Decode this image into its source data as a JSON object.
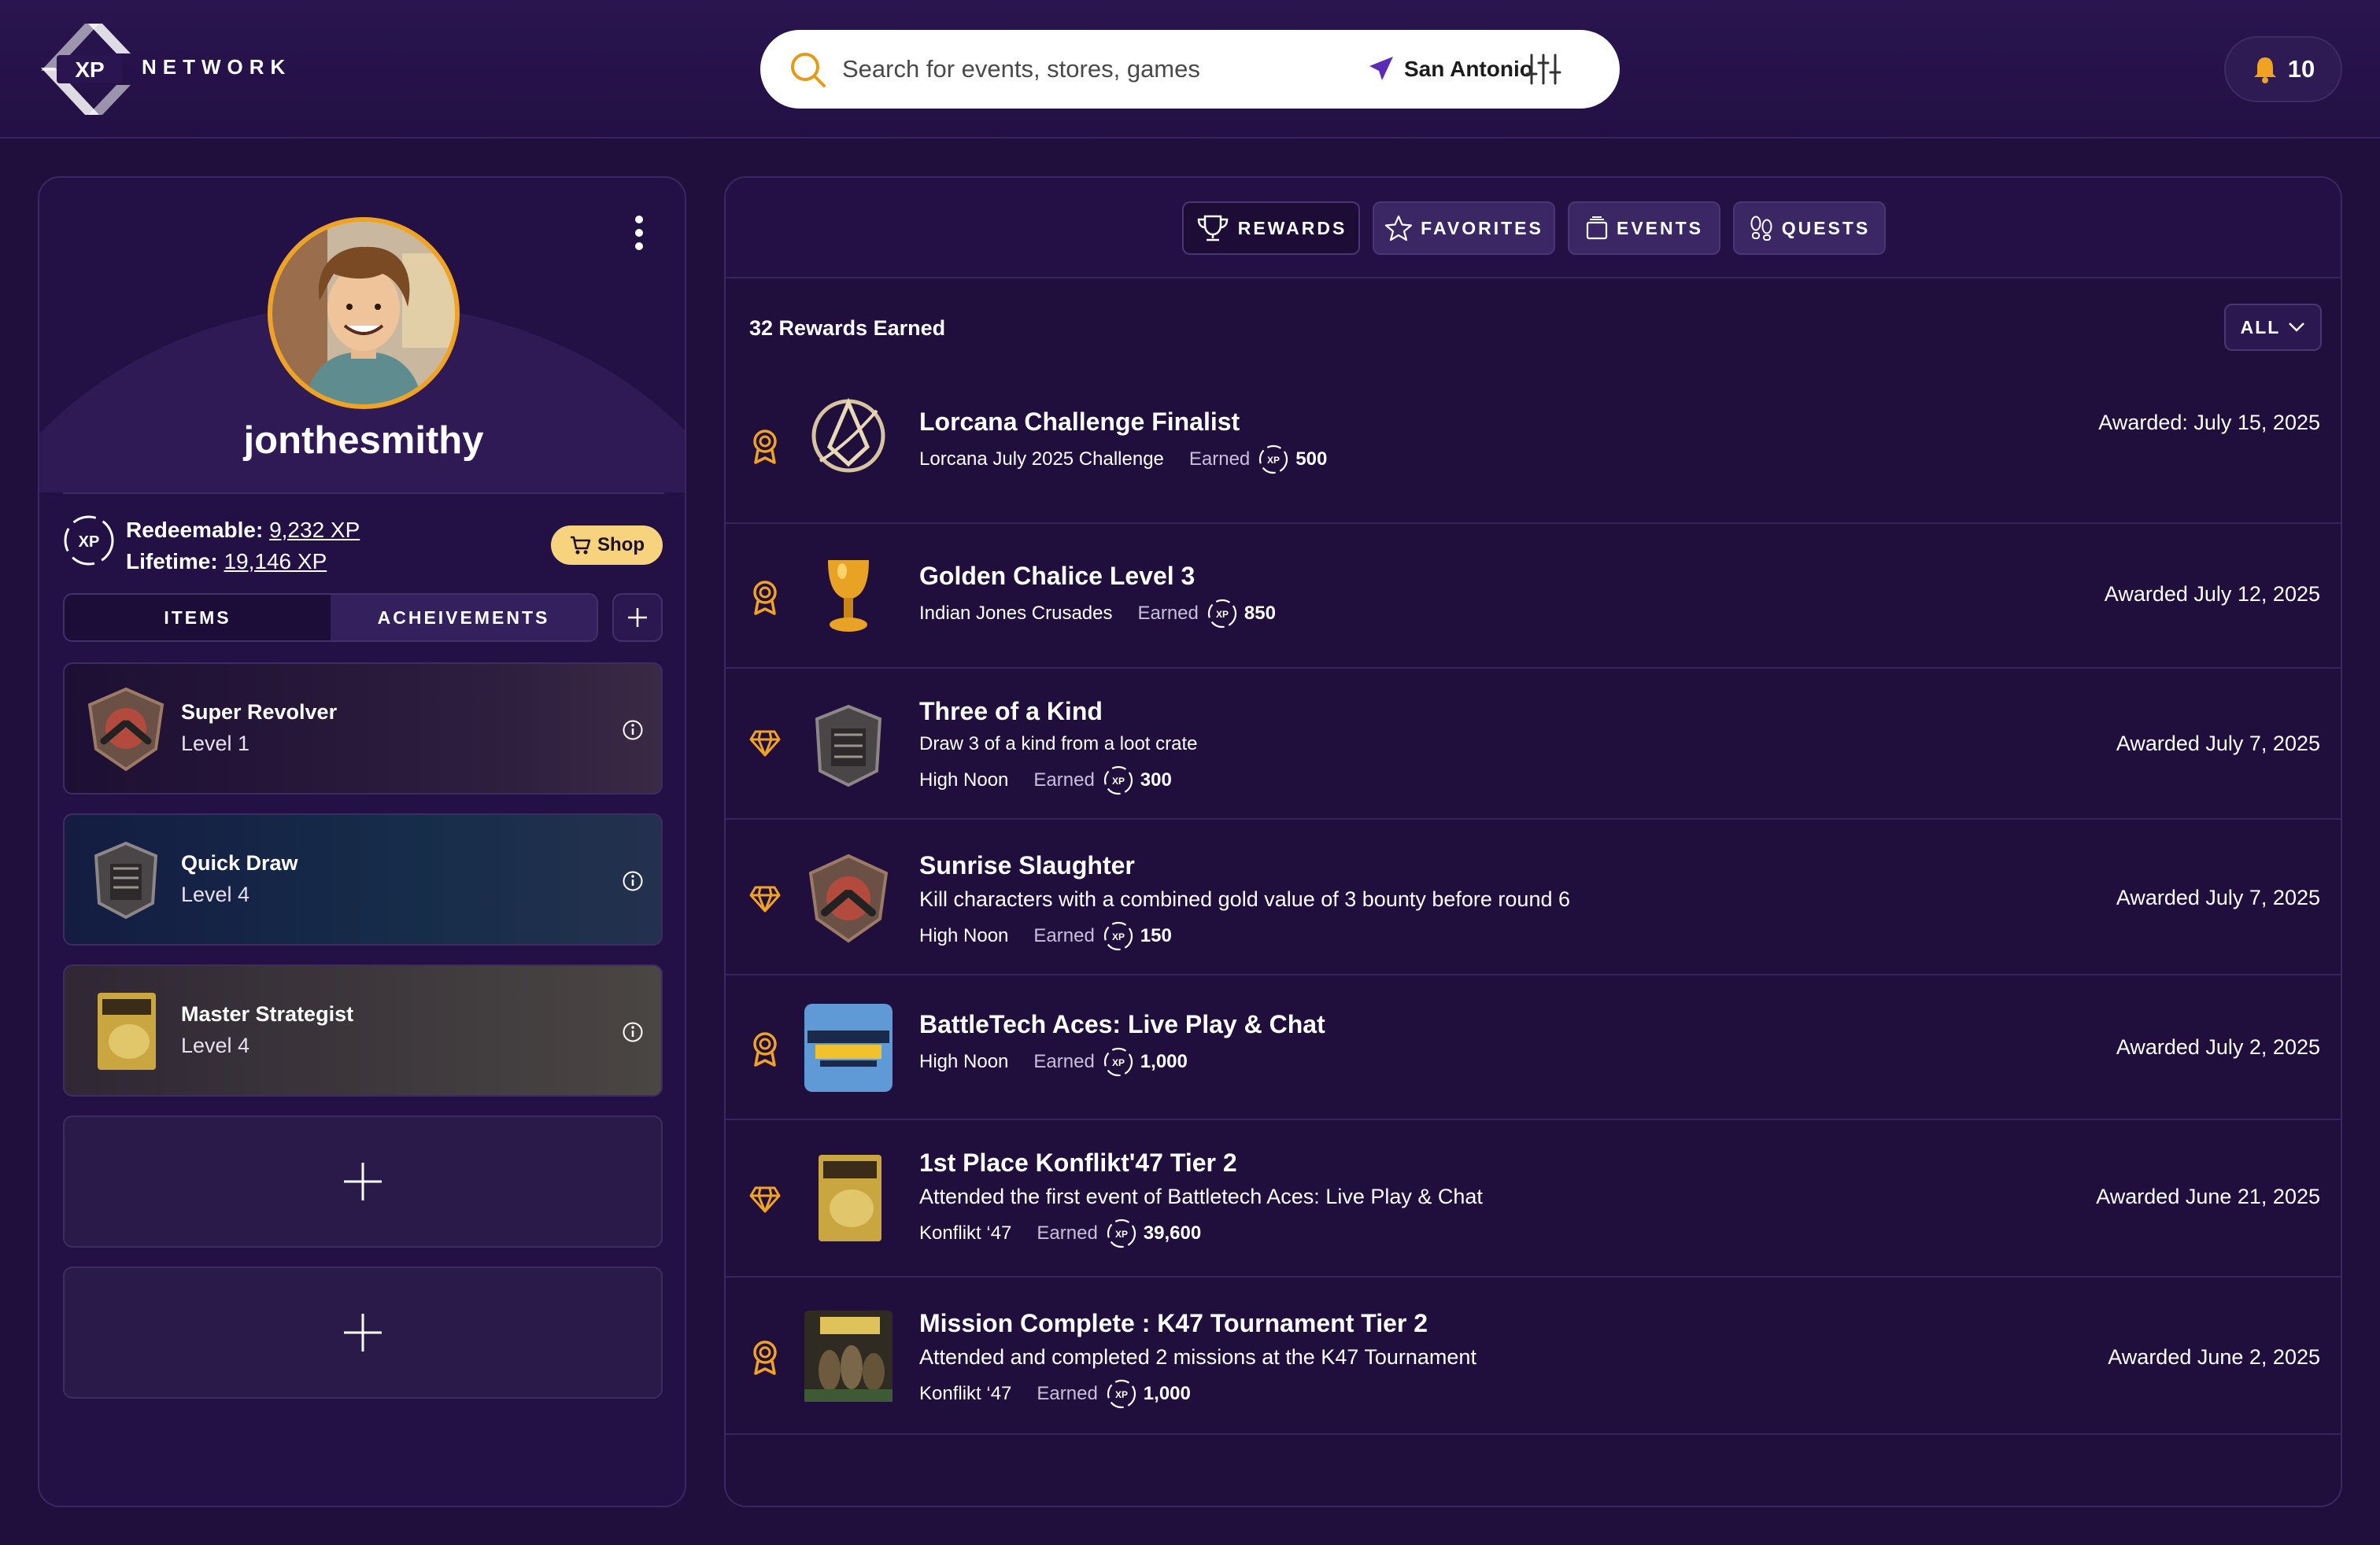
{
  "brand": {
    "xp": "XP",
    "network": "NETWORK"
  },
  "search": {
    "placeholder": "Search for events, stores, games",
    "location": "San Antonio"
  },
  "notifications": {
    "count": "10"
  },
  "profile": {
    "username": "jonthesmithy",
    "redeemable_label": "Redeemable:",
    "redeemable_value": "9,232 XP",
    "lifetime_label": "Lifetime:",
    "lifetime_value": "19,146 XP",
    "shop_label": "Shop",
    "tabs": [
      "ITEMS",
      "ACHEIVEMENTS"
    ],
    "achievements": [
      {
        "name": "Super Revolver",
        "level": "Level 1"
      },
      {
        "name": "Quick Draw",
        "level": "Level 4"
      },
      {
        "name": "Master Strategist",
        "level": "Level 4"
      }
    ]
  },
  "rewards": {
    "tabs": [
      "REWARDS",
      "FAVORITES",
      "EVENTS",
      "QUESTS"
    ],
    "count_label": "32 Rewards Earned",
    "filter_label": "ALL",
    "earned_label": "Earned",
    "items": [
      {
        "title": "Lorcana Challenge Finalist",
        "desc": "",
        "source": "Lorcana July 2025 Challenge",
        "points": "500",
        "date": "Awarded: July 15, 2025",
        "type": "medal-icon"
      },
      {
        "title": "Golden Chalice Level 3",
        "desc": "",
        "source": "Indian Jones Crusades",
        "points": "850",
        "date": "Awarded July 12, 2025",
        "type": "medal-icon"
      },
      {
        "title": "Three of a Kind",
        "desc": "Draw 3 of a kind from a loot crate",
        "source": "High Noon",
        "points": "300",
        "date": "Awarded July 7, 2025",
        "type": "diamond-icon"
      },
      {
        "title": "Sunrise Slaughter",
        "desc": "Kill characters with a combined gold value of 3 bounty before round 6",
        "source": "High Noon",
        "points": "150",
        "date": "Awarded July 7, 2025",
        "type": "diamond-icon"
      },
      {
        "title": "BattleTech Aces: Live Play & Chat",
        "desc": "",
        "source": "High Noon",
        "points": "1,000",
        "date": "Awarded July 2, 2025",
        "type": "medal-icon"
      },
      {
        "title": "1st Place Konflikt'47 Tier 2",
        "desc": "Attended the first event of Battletech Aces: Live Play & Chat",
        "source": "Konflikt ‘47",
        "points": "39,600",
        "date": "Awarded June 21, 2025",
        "type": "diamond-icon"
      },
      {
        "title": "Mission Complete : K47 Tournament Tier 2",
        "desc": "Attended and completed 2 missions at the K47 Tournament",
        "source": "Konflikt ‘47",
        "points": "1,000",
        "date": "Awarded June 2, 2025",
        "type": "medal-icon"
      }
    ]
  },
  "colors": {
    "accent": "#f0a320",
    "background": "#200e3d",
    "shop": "#f6d37c",
    "location_arrow": "#5b2bb5"
  }
}
